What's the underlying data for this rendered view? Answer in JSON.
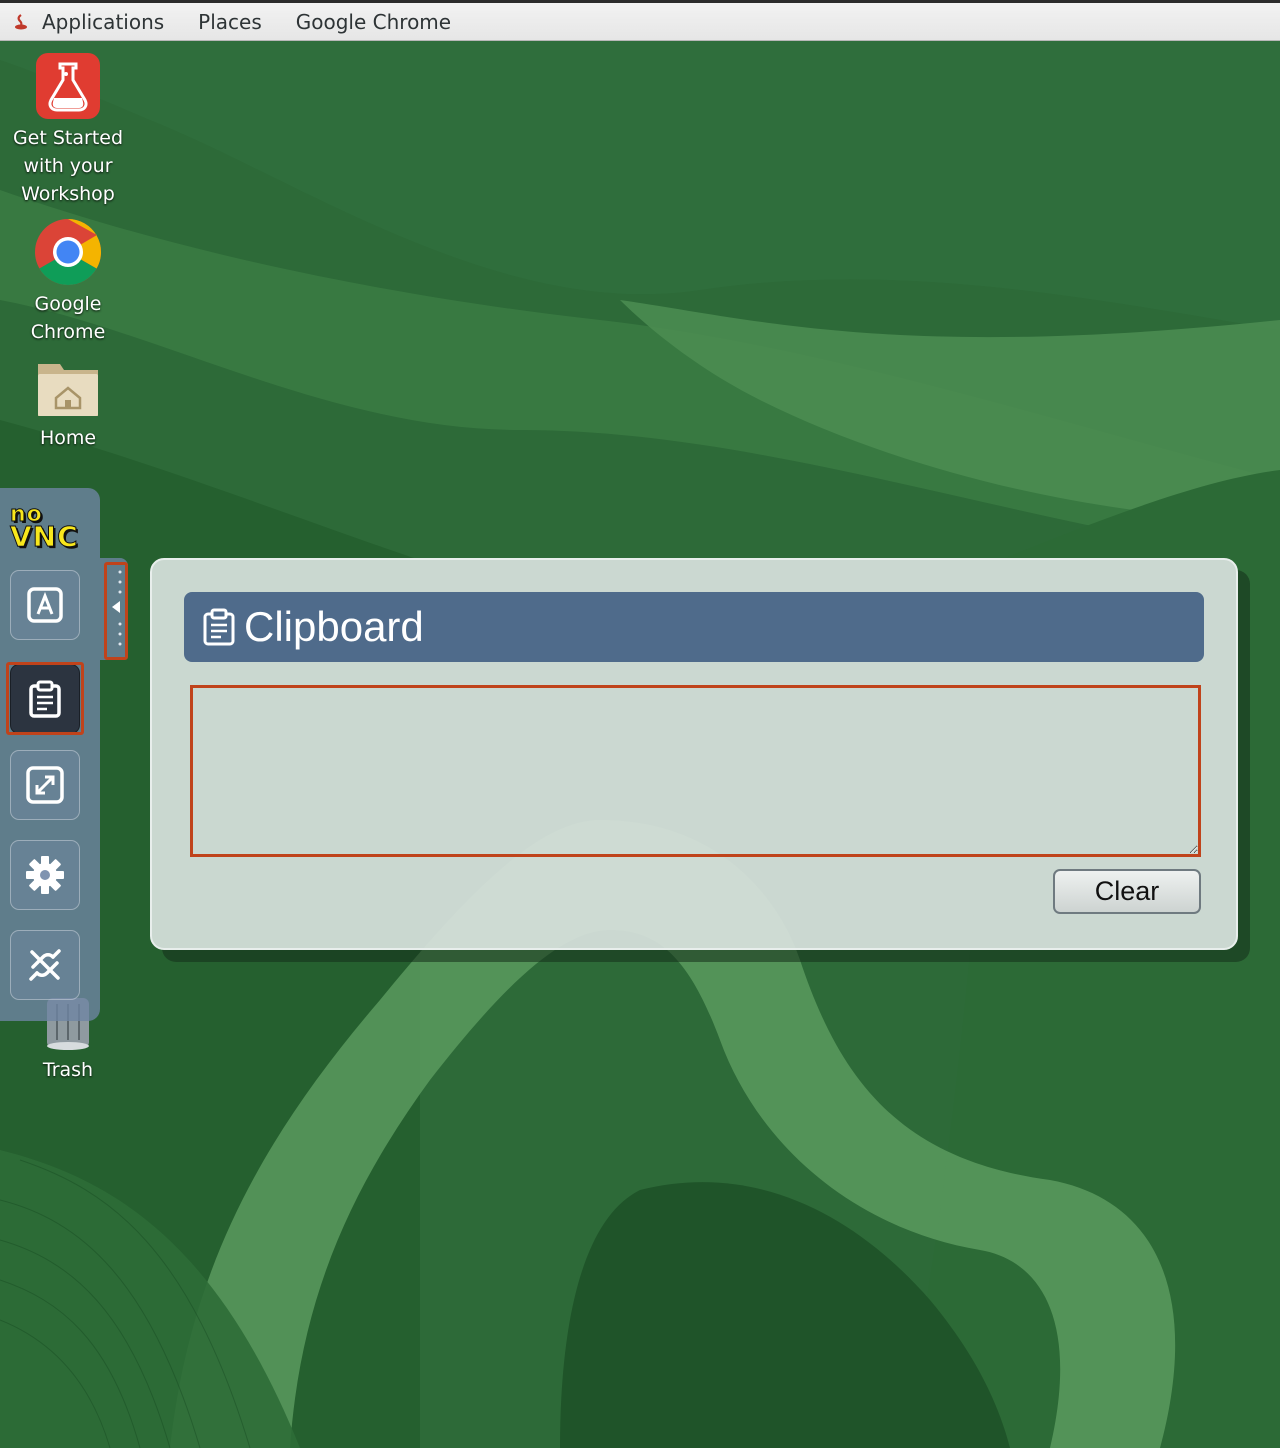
{
  "topbar": {
    "applications": "Applications",
    "places": "Places",
    "google_chrome": "Google Chrome"
  },
  "desktop": {
    "icons": [
      {
        "label": "Get Started\nwith your\nWorkshop",
        "icon": "flask-icon"
      },
      {
        "label": "Google\nChrome",
        "icon": "chrome-icon"
      },
      {
        "label": "Home",
        "icon": "home-folder-icon"
      },
      {
        "label": "Trash",
        "icon": "trash-icon"
      }
    ]
  },
  "novnc": {
    "logo_top": "no",
    "logo_bottom": "VNC",
    "buttons": [
      {
        "name": "extra-keys",
        "icon": "keyboard-a-icon"
      },
      {
        "name": "clipboard",
        "icon": "clipboard-icon",
        "active": true
      },
      {
        "name": "fullscreen",
        "icon": "fullscreen-icon"
      },
      {
        "name": "settings",
        "icon": "gear-icon"
      },
      {
        "name": "disconnect",
        "icon": "disconnect-icon"
      }
    ],
    "handle_icon": "caret-left-icon"
  },
  "clipboard": {
    "title": "Clipboard",
    "text": "",
    "clear_label": "Clear"
  },
  "colors": {
    "accent_highlight": "#c0431b",
    "panel_header": "#4f6b8b",
    "wallpaper_dark": "#1f5a2c",
    "wallpaper_light": "#4e8f54"
  }
}
